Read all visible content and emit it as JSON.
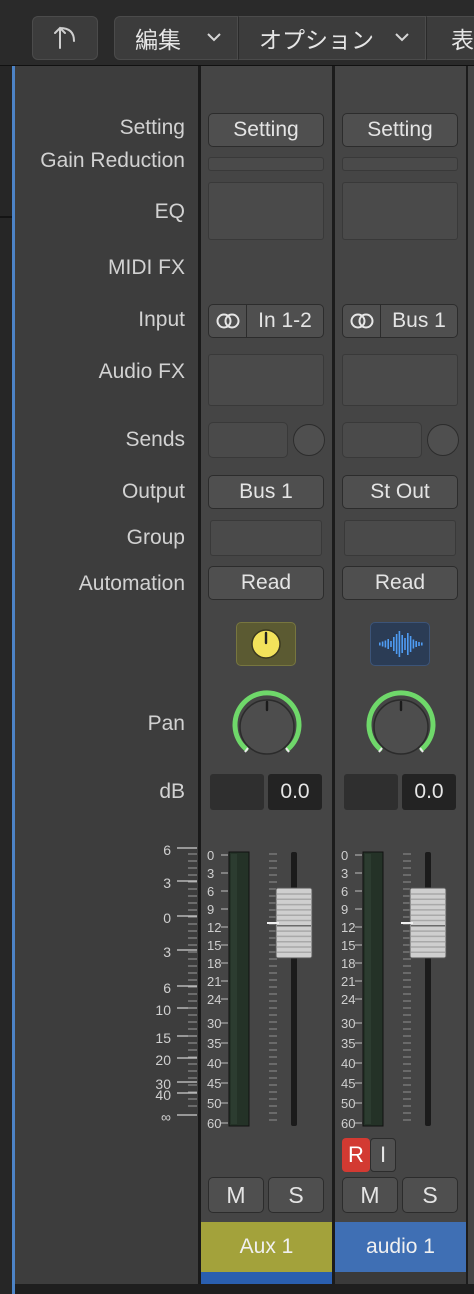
{
  "toolbar": {
    "back_icon": "up-arrow-return-icon",
    "edit_label": "編集",
    "options_label": "オプション",
    "view_label": "表"
  },
  "rows": {
    "setting": "Setting",
    "gain_reduction": "Gain Reduction",
    "eq": "EQ",
    "midi_fx": "MIDI FX",
    "input": "Input",
    "audio_fx": "Audio FX",
    "sends": "Sends",
    "output": "Output",
    "group": "Group",
    "automation": "Automation",
    "pan": "Pan",
    "db": "dB"
  },
  "fader_scale_left": [
    "6",
    "3",
    "0",
    "3",
    "6",
    "10",
    "15",
    "20",
    "30",
    "40",
    "∞"
  ],
  "meter_scale": [
    "0",
    "3",
    "6",
    "9",
    "12",
    "15",
    "18",
    "21",
    "24",
    "30",
    "35",
    "40",
    "45",
    "50",
    "60"
  ],
  "strips": [
    {
      "setting": "Setting",
      "input_label": "In 1-2",
      "output_label": "Bus 1",
      "automation": "Read",
      "icon": "aux-knob-icon",
      "icon_color": "#f2e25b",
      "icon_bg": "#5b5a32",
      "pan": 0,
      "db_value": "0.0",
      "fader_db": 0,
      "mute": "M",
      "solo": "S",
      "record": null,
      "input_monitor": null,
      "name": "Aux 1",
      "name_color": "#a3a23b",
      "underbar_color": "#2a5fb0"
    },
    {
      "setting": "Setting",
      "input_label": "Bus 1",
      "output_label": "St Out",
      "automation": "Read",
      "icon": "waveform-icon",
      "icon_color": "#4f9cf3",
      "icon_bg": "#2b3c55",
      "pan": 0,
      "db_value": "0.0",
      "fader_db": 0,
      "mute": "M",
      "solo": "S",
      "record": "R",
      "input_monitor": "I",
      "name": "audio 1",
      "name_color": "#3f6fb4",
      "underbar_color": "#3a3a3a"
    }
  ],
  "colors": {
    "pan_ring": "#6fd86a",
    "record_red": "#d33a32",
    "panel": "#3d3d3d",
    "strip": "#454545"
  }
}
